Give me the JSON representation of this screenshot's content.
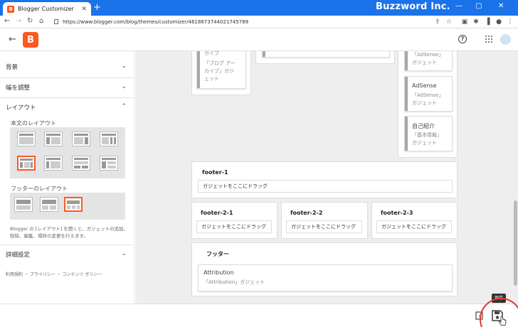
{
  "browser": {
    "tab_title": "Blogger Customizer",
    "tab_close": "✕",
    "new_tab": "+",
    "url": "https://www.blogger.com/blog/themes/customizer/4618673744021745789",
    "brand": "Buzzword Inc.",
    "win_min": "—",
    "win_max": "▢",
    "win_close": "✕"
  },
  "header": {
    "back": "←",
    "logo": "B",
    "help": "?"
  },
  "sidebar": {
    "sections": {
      "background": "背景",
      "width": "幅を調整",
      "layout": "レイアウト",
      "advanced": "詳細設定"
    },
    "body_layout_label": "本文のレイアウト",
    "footer_layout_label": "フッターのレイアウト",
    "help_text": "Blogger の [レイアウト] を開くと、ガジェットの追加、削除、編集、場所の変更を行えます。",
    "footer_links": "利用規約 ・ プライバシー ・ コンテンツ ポリシー",
    "selected_body_layout": 4,
    "selected_footer_layout": 2
  },
  "main": {
    "gadgets": {
      "archive_title": "ガイブ",
      "archive_sub1": "「ブログ アー",
      "archive_sub2": "カイブ」ガジ",
      "archive_sub3": "ェット",
      "top_adsense_sub": "「AdSense」",
      "top_adsense_sub2": "ガジェット",
      "adsense_title": "AdSense",
      "adsense_sub1": "「AdSense」",
      "adsense_sub2": "ガジェット",
      "profile_title": "自己紹介",
      "profile_sub1": "「基本情報」",
      "profile_sub2": "ガジェット"
    },
    "footer1": {
      "title": "footer-1",
      "drop": "ガジェットをここにドラッグ"
    },
    "footer2_1": {
      "title": "footer-2-1",
      "drop": "ガジェットをここにドラッグ"
    },
    "footer2_2": {
      "title": "footer-2-2",
      "drop": "ガジェットをここにドラッグ"
    },
    "footer2_3": {
      "title": "footer-2-3",
      "drop": "ガジェットをここにドラッグ"
    },
    "footer3": {
      "title": "フッター",
      "gadget_title": "Attribution",
      "gadget_sub": "「Attribution」ガジェット"
    }
  },
  "bottom": {
    "tooltip": "保存"
  }
}
